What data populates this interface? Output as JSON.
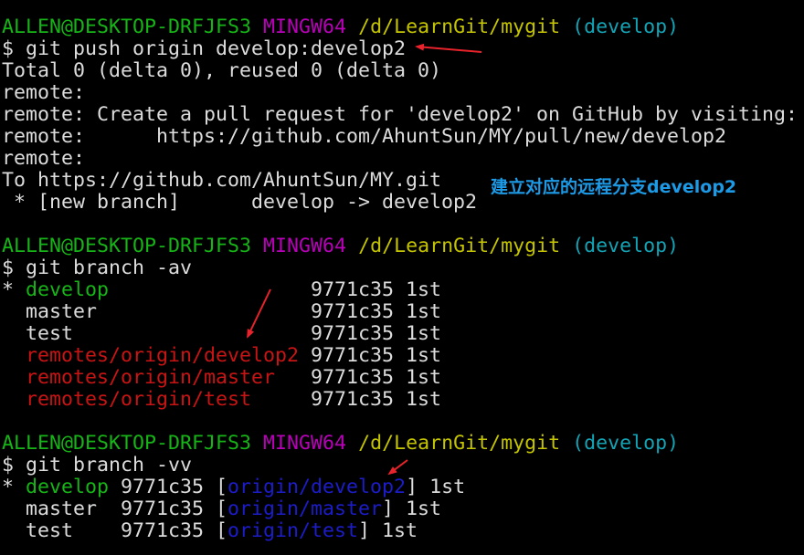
{
  "colors": {
    "background": "#000000",
    "white": "#dcdcdc",
    "green": "#16b416",
    "magenta": "#b800b8",
    "yellow": "#c4c400",
    "cyan": "#14a3b5",
    "red": "#c81414",
    "blue": "#1c1cc8",
    "annotation": "#1d9ae6",
    "arrow": "#e8232b"
  },
  "terminal": {
    "lines": [
      {
        "segments": [
          {
            "text": "ALLEN@DESKTOP-DRFJFS3",
            "color": "green"
          },
          {
            "text": " "
          },
          {
            "text": "MINGW64",
            "color": "magenta"
          },
          {
            "text": " "
          },
          {
            "text": "/d/LearnGit/mygit",
            "color": "yellow"
          },
          {
            "text": " "
          },
          {
            "text": "(develop)",
            "color": "cyan"
          }
        ]
      },
      {
        "segments": [
          {
            "text": "$ git push origin develop:develop2"
          }
        ]
      },
      {
        "segments": [
          {
            "text": "Total 0 (delta 0), reused 0 (delta 0)"
          }
        ]
      },
      {
        "segments": [
          {
            "text": "remote:"
          }
        ]
      },
      {
        "segments": [
          {
            "text": "remote: Create a pull request for 'develop2' on GitHub by visiting:"
          }
        ]
      },
      {
        "segments": [
          {
            "text": "remote:      https://github.com/AhuntSun/MY/pull/new/develop2"
          }
        ]
      },
      {
        "segments": [
          {
            "text": "remote:"
          }
        ]
      },
      {
        "segments": [
          {
            "text": "To https://github.com/AhuntSun/MY.git"
          }
        ]
      },
      {
        "segments": [
          {
            "text": " * [new branch]      develop -> develop2"
          }
        ]
      },
      {
        "segments": []
      },
      {
        "segments": [
          {
            "text": "ALLEN@DESKTOP-DRFJFS3",
            "color": "green"
          },
          {
            "text": " "
          },
          {
            "text": "MINGW64",
            "color": "magenta"
          },
          {
            "text": " "
          },
          {
            "text": "/d/LearnGit/mygit",
            "color": "yellow"
          },
          {
            "text": " "
          },
          {
            "text": "(develop)",
            "color": "cyan"
          }
        ]
      },
      {
        "segments": [
          {
            "text": "$ git branch -av"
          }
        ]
      },
      {
        "segments": [
          {
            "text": "* "
          },
          {
            "text": "develop",
            "color": "green"
          },
          {
            "text": "                 9771c35 1st"
          }
        ]
      },
      {
        "segments": [
          {
            "text": "  master                  9771c35 1st"
          }
        ]
      },
      {
        "segments": [
          {
            "text": "  test                    9771c35 1st"
          }
        ]
      },
      {
        "segments": [
          {
            "text": "  "
          },
          {
            "text": "remotes/origin/develop2",
            "color": "red"
          },
          {
            "text": " 9771c35 1st"
          }
        ]
      },
      {
        "segments": [
          {
            "text": "  "
          },
          {
            "text": "remotes/origin/master",
            "color": "red"
          },
          {
            "text": "   9771c35 1st"
          }
        ]
      },
      {
        "segments": [
          {
            "text": "  "
          },
          {
            "text": "remotes/origin/test",
            "color": "red"
          },
          {
            "text": "     9771c35 1st"
          }
        ]
      },
      {
        "segments": []
      },
      {
        "segments": [
          {
            "text": "ALLEN@DESKTOP-DRFJFS3",
            "color": "green"
          },
          {
            "text": " "
          },
          {
            "text": "MINGW64",
            "color": "magenta"
          },
          {
            "text": " "
          },
          {
            "text": "/d/LearnGit/mygit",
            "color": "yellow"
          },
          {
            "text": " "
          },
          {
            "text": "(develop)",
            "color": "cyan"
          }
        ]
      },
      {
        "segments": [
          {
            "text": "$ git branch -vv"
          }
        ]
      },
      {
        "segments": [
          {
            "text": "* "
          },
          {
            "text": "develop",
            "color": "green"
          },
          {
            "text": " 9771c35 ["
          },
          {
            "text": "origin/develop2",
            "color": "blue"
          },
          {
            "text": "] 1st"
          }
        ]
      },
      {
        "segments": [
          {
            "text": "  master  9771c35 ["
          },
          {
            "text": "origin/master",
            "color": "blue"
          },
          {
            "text": "] 1st"
          }
        ]
      },
      {
        "segments": [
          {
            "text": "  test    9771c35 ["
          },
          {
            "text": "origin/test",
            "color": "blue"
          },
          {
            "text": "] 1st"
          }
        ]
      }
    ]
  },
  "annotation": {
    "text": "建立对应的远程分支develop2"
  }
}
